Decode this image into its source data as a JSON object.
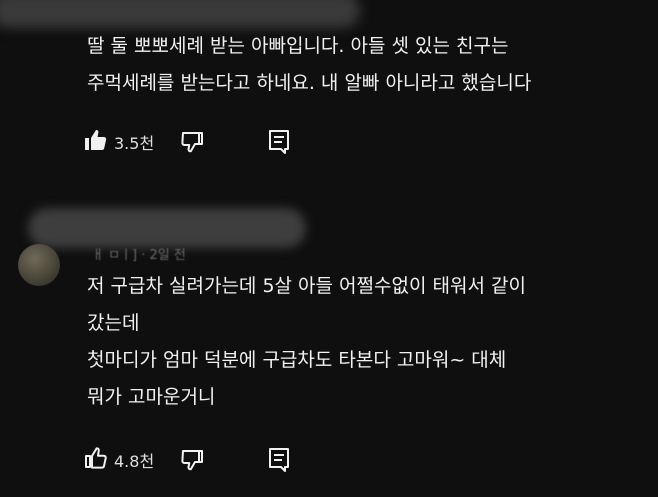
{
  "comment1": {
    "lines": [
      "딸 둘 뽀뽀세례 받는 아빠입니다. 아들 셋 있는 친구는",
      "주먹세례를 받는다고 하네요. 내 알빠 아니라고 했습니다"
    ],
    "likes": "3.5천"
  },
  "comment2": {
    "header_partial": "ㅐ ㅁㅣ] · 2일 전",
    "lines": [
      "저 구급차 실려가는데 5살 아들 어쩔수없이 태워서 같이",
      "갔는데",
      "첫마디가 엄마 덕분에 구급차도 타본다 고마워~  대체",
      "뭐가 고마운거니"
    ],
    "likes": "4.8천"
  },
  "icons": {
    "like": "thumbs-up-icon",
    "dislike": "thumbs-down-icon",
    "reply": "reply-icon"
  },
  "colors": {
    "background": "#0f0f0f",
    "text": "#f1f1f1"
  }
}
